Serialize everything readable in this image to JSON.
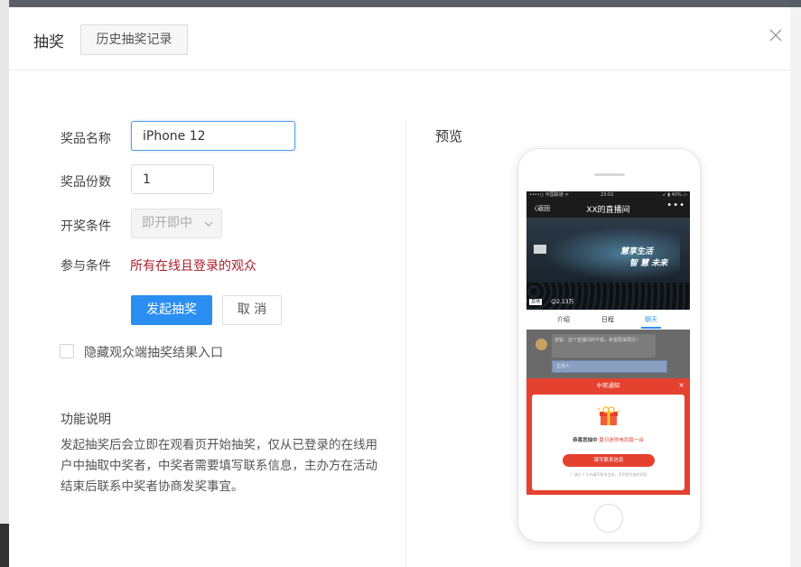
{
  "dialog": {
    "title": "抽奖",
    "history_button": "历史抽奖记录"
  },
  "form": {
    "prize_name_label": "奖品名称",
    "prize_name_value": "iPhone 12",
    "prize_count_label": "奖品份数",
    "prize_count_value": "1",
    "draw_condition_label": "开奖条件",
    "draw_condition_value": "即开即中",
    "join_condition_label": "参与条件",
    "join_condition_value": "所有在线且登录的观众",
    "submit_button": "发起抽奖",
    "cancel_button": "取 消",
    "hide_entry_label": "隐藏观众端抽奖结果入口",
    "hide_entry_checked": false
  },
  "description": {
    "title": "功能说明",
    "text": "发起抽奖后会立即在观看页开始抽奖，仅从已登录的在线用户中抽取中奖者，中奖者需要填写联系信息，主办方在活动结束后联系中奖者协商发奖事宜。"
  },
  "preview": {
    "title": "预览",
    "phone": {
      "status_left": "••••○ 中国联通 ᯤ",
      "status_time": "23:02",
      "status_right": "➶ ▮ 40% ▭",
      "back_label": "〈返回",
      "room_title": "XX的直播间",
      "more_label": "•••",
      "slogan_line1": "慧享生活",
      "slogan_line2": "智 慧 未来",
      "live_badge": "直播",
      "view_count": "☺2.13万",
      "tabs": [
        "介绍",
        "日程",
        "聊天"
      ],
      "active_tab": 2,
      "chat_bubble": "游客：这个直播间的不错，希望再接再厉！",
      "chat_input_placeholder": "主持人：",
      "popup_title": "中奖通知",
      "popup_close": "×",
      "popup_message_prefix": "恭喜您抽中",
      "popup_message_prize": "夏日迷你电风扇一台",
      "popup_button": "填写联系信息",
      "popup_tip": "ⓘ 请在 3 天内填写联系信息，否则视为放弃领奖"
    }
  },
  "colors": {
    "primary": "#2a8ff0",
    "condition_text": "#a8202c",
    "popup_red": "#e5412f",
    "focus_border": "#5a9be8"
  },
  "icons": {
    "close": "close-icon",
    "chevron": "chevron-down-icon",
    "gift": "gift-icon"
  }
}
